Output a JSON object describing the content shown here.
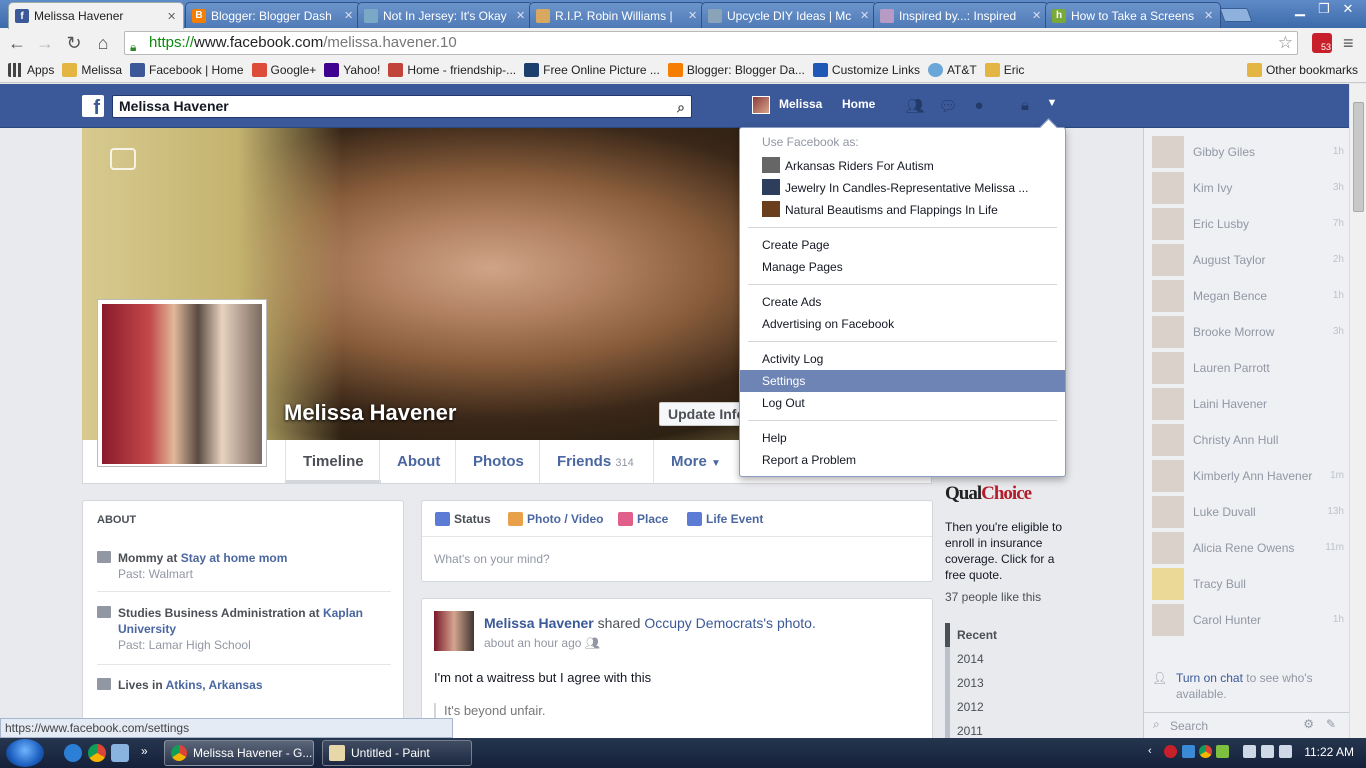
{
  "browser": {
    "tabs": [
      {
        "title": "Melissa Havener",
        "icon": "facebook-icon",
        "color": "#3b5998",
        "active": true
      },
      {
        "title": "Blogger: Blogger Dash",
        "icon": "blogger-icon",
        "color": "#f57d00"
      },
      {
        "title": "Not In Jersey: It's Okay",
        "icon": "blog-icon",
        "color": "#7aa9c7"
      },
      {
        "title": "R.I.P. Robin Williams |",
        "icon": "page-icon",
        "color": "#d9a860"
      },
      {
        "title": "Upcycle DIY Ideas | Mc",
        "icon": "page-icon",
        "color": "#8aa3b9"
      },
      {
        "title": "Inspired by...: Inspired",
        "icon": "page-icon",
        "color": "#b79bc5"
      },
      {
        "title": "How to Take a Screens",
        "icon": "wikihow-icon",
        "color": "#79a937"
      }
    ],
    "url_scheme": "https://",
    "url_host": "www.facebook.com",
    "url_path": "/melissa.havener.10",
    "extension_badge": "53",
    "bookmarks": [
      {
        "label": "Apps",
        "icon": "apps-grid-icon"
      },
      {
        "label": "Melissa",
        "icon": "folder-icon"
      },
      {
        "label": "Facebook | Home",
        "icon": "facebook-icon"
      },
      {
        "label": "Google+",
        "icon": "googleplus-icon"
      },
      {
        "label": "Yahoo!",
        "icon": "yahoo-icon"
      },
      {
        "label": "Home - friendship-...",
        "icon": "page-icon"
      },
      {
        "label": "Free Online Picture ...",
        "icon": "page-icon"
      },
      {
        "label": "Blogger: Blogger Da...",
        "icon": "blogger-icon"
      },
      {
        "label": "Customize Links",
        "icon": "msn-icon"
      },
      {
        "label": "AT&T",
        "icon": "att-icon"
      },
      {
        "label": "Eric",
        "icon": "folder-icon"
      }
    ],
    "other_bookmarks": "Other bookmarks",
    "status_url": "https://www.facebook.com/settings"
  },
  "fb": {
    "search_value": "Melissa Havener",
    "user_short": "Melissa",
    "home_label": "Home",
    "profile_name": "Melissa Havener",
    "update_info": "Update Info",
    "tabs": [
      {
        "label": "Timeline"
      },
      {
        "label": "About"
      },
      {
        "label": "Photos"
      },
      {
        "label": "Friends",
        "count": "314"
      },
      {
        "label": "More"
      }
    ],
    "about": {
      "heading": "ABOUT",
      "work_prefix": "Mommy at ",
      "work_link": "Stay at home mom",
      "work_past": "Past: Walmart",
      "study": "Studies Business Administration at ",
      "study_link": "Kaplan University",
      "study_past": "Past: Lamar High School",
      "lives": "Lives in ",
      "lives_link": "Atkins, Arkansas"
    },
    "composer": {
      "tabs": [
        "Status",
        "Photo / Video",
        "Place",
        "Life Event"
      ],
      "prompt": "What's on your mind?"
    },
    "post": {
      "author": "Melissa Havener",
      "shared": " shared ",
      "page": "Occupy Democrats",
      "photo_suffix": "'s photo.",
      "time": "about an hour ago",
      "text": "I'm not a waitress but I agree with this",
      "quote": "It's beyond unfair."
    },
    "ad": {
      "brand_a": "Qual",
      "brand_b": "Choice",
      "text": "Then you're eligible to enroll in insurance coverage. Click for a free quote.",
      "likes": "37 people like this"
    },
    "years": [
      "Recent",
      "2014",
      "2013",
      "2012",
      "2011"
    ],
    "chat_friends": [
      {
        "name": "Gibby Giles",
        "time": "1h"
      },
      {
        "name": "Kim Ivy",
        "time": "3h"
      },
      {
        "name": "Eric Lusby",
        "time": "7h"
      },
      {
        "name": "August Taylor",
        "time": "2h"
      },
      {
        "name": "Megan Bence",
        "time": "1h"
      },
      {
        "name": "Brooke Morrow",
        "time": "3h"
      },
      {
        "name": "Lauren Parrott",
        "time": ""
      },
      {
        "name": "Laini Havener",
        "time": ""
      },
      {
        "name": "Christy Ann Hull",
        "time": ""
      },
      {
        "name": "Kimberly Ann Havener",
        "time": "1m"
      },
      {
        "name": "Luke Duvall",
        "time": "13h"
      },
      {
        "name": "Alicia Rene Owens",
        "time": "11m"
      },
      {
        "name": "Tracy Bull",
        "time": ""
      },
      {
        "name": "Carol Hunter",
        "time": "1h"
      }
    ],
    "chat_on_link": "Turn on chat",
    "chat_on_rest": " to see who's available.",
    "chat_search": "Search"
  },
  "dropdown": {
    "heading": "Use Facebook as:",
    "pages": [
      "Arkansas Riders For Autism",
      "Jewelry In Candles-Representative Melissa ...",
      "Natural Beautisms and Flappings In Life"
    ],
    "group2": [
      "Create Page",
      "Manage Pages"
    ],
    "group3": [
      "Create Ads",
      "Advertising on Facebook"
    ],
    "group4": [
      "Activity Log",
      "Settings",
      "Log Out"
    ],
    "group5": [
      "Help",
      "Report a Problem"
    ],
    "highlighted": "Settings"
  },
  "taskbar": {
    "tasks": [
      "Melissa Havener - G...",
      "Untitled - Paint"
    ],
    "clock": "11:22 AM"
  },
  "colors": {
    "fb_blue": "#3b5998",
    "link": "#4b67a1",
    "highlight": "#6d84b4"
  }
}
